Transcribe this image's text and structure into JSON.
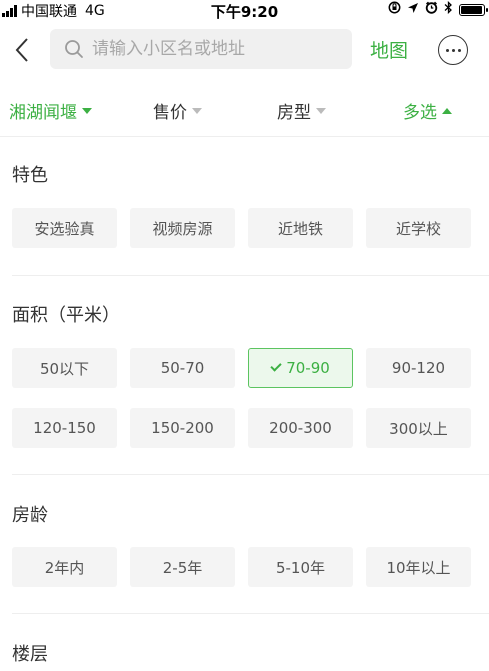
{
  "status_bar": {
    "carrier": "中国联通",
    "network": "4G",
    "time": "下午9:20",
    "battery_level": 0.95
  },
  "search": {
    "placeholder": "请输入小区名或地址"
  },
  "nav": {
    "map_label": "地图"
  },
  "filters": [
    {
      "label": "湘湖闻堰",
      "active": true
    },
    {
      "label": "售价",
      "active": false
    },
    {
      "label": "房型",
      "active": false
    },
    {
      "label": "多选",
      "active": true
    }
  ],
  "sections": {
    "features": {
      "title": "特色",
      "options": [
        "安选验真",
        "视频房源",
        "近地铁",
        "近学校"
      ]
    },
    "area": {
      "title": "面积（平米）",
      "options": [
        "50以下",
        "50-70",
        "70-90",
        "90-120",
        "120-150",
        "150-200",
        "200-300",
        "300以上"
      ],
      "selected": "70-90"
    },
    "age": {
      "title": "房龄",
      "options": [
        "2年内",
        "2-5年",
        "5-10年",
        "10年以上"
      ]
    },
    "floor": {
      "title": "楼层"
    }
  },
  "colors": {
    "accent": "#3cb043",
    "option_bg": "#f4f4f4",
    "selected_bg": "#ecf8ec"
  }
}
